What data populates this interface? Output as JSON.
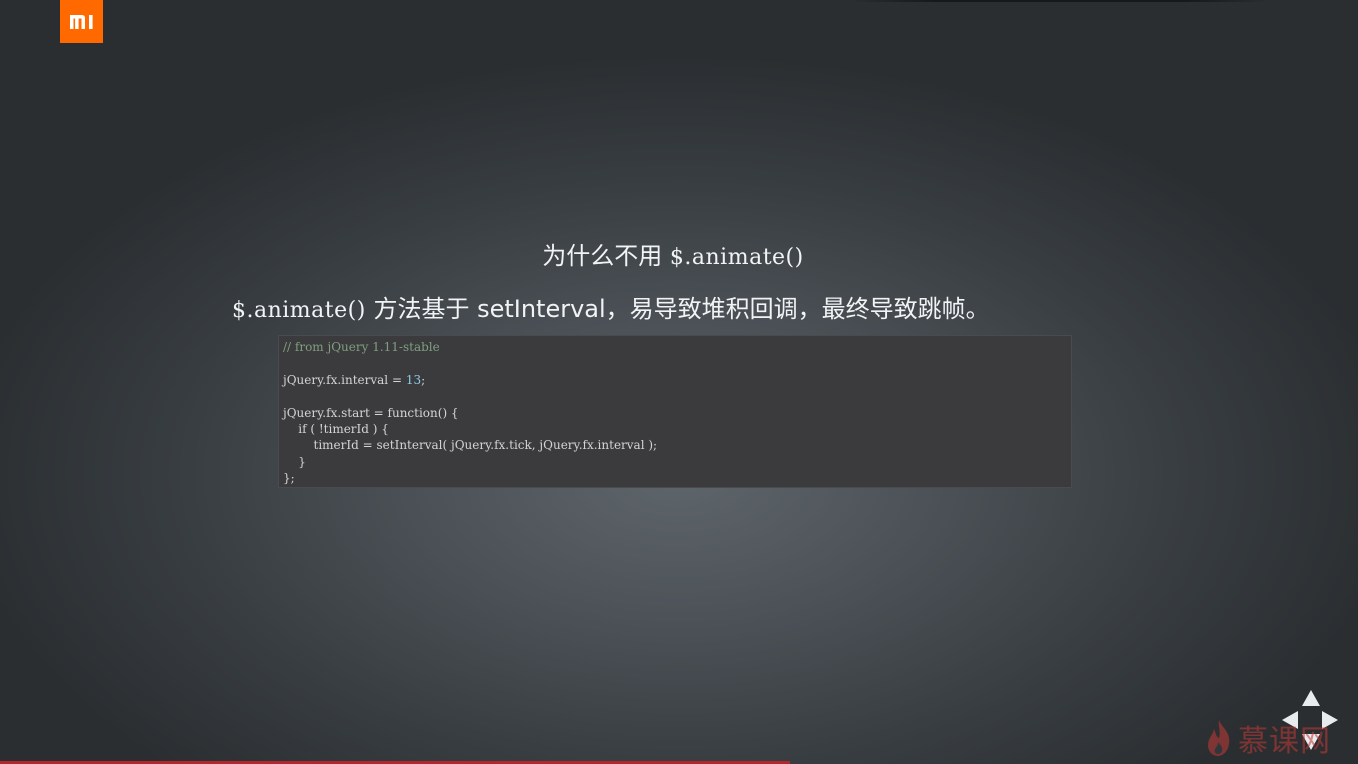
{
  "slide": {
    "title_text": "为什么不用 ",
    "title_code": "$.animate()",
    "subtitle_code": "$.animate()",
    "subtitle_text": " 方法基于 setInterval，易导致堆积回调，最终导致跳帧。"
  },
  "code": {
    "comment": "// from jQuery 1.11-stable",
    "blank_1": " ",
    "line_interval_prefix": "jQuery.fx.interval = ",
    "line_interval_value": "13",
    "line_interval_suffix": ";",
    "blank_2": " ",
    "line_start": "jQuery.fx.start = function() {",
    "line_if": "    if ( !timerId ) {",
    "line_set": "        timerId = setInterval( jQuery.fx.tick, jQuery.fx.interval );",
    "line_close_if": "    }",
    "line_close_fn": "};"
  },
  "branding": {
    "logo_icon": "mi-logo-icon",
    "watermark_text": "慕课网",
    "watermark_icon": "flame-icon",
    "accent_color": "#ff6900",
    "progress_color": "#b0272e"
  },
  "navigation": {
    "icons": [
      "arrow-up-icon",
      "arrow-left-icon",
      "arrow-right-icon",
      "arrow-down-icon"
    ]
  }
}
